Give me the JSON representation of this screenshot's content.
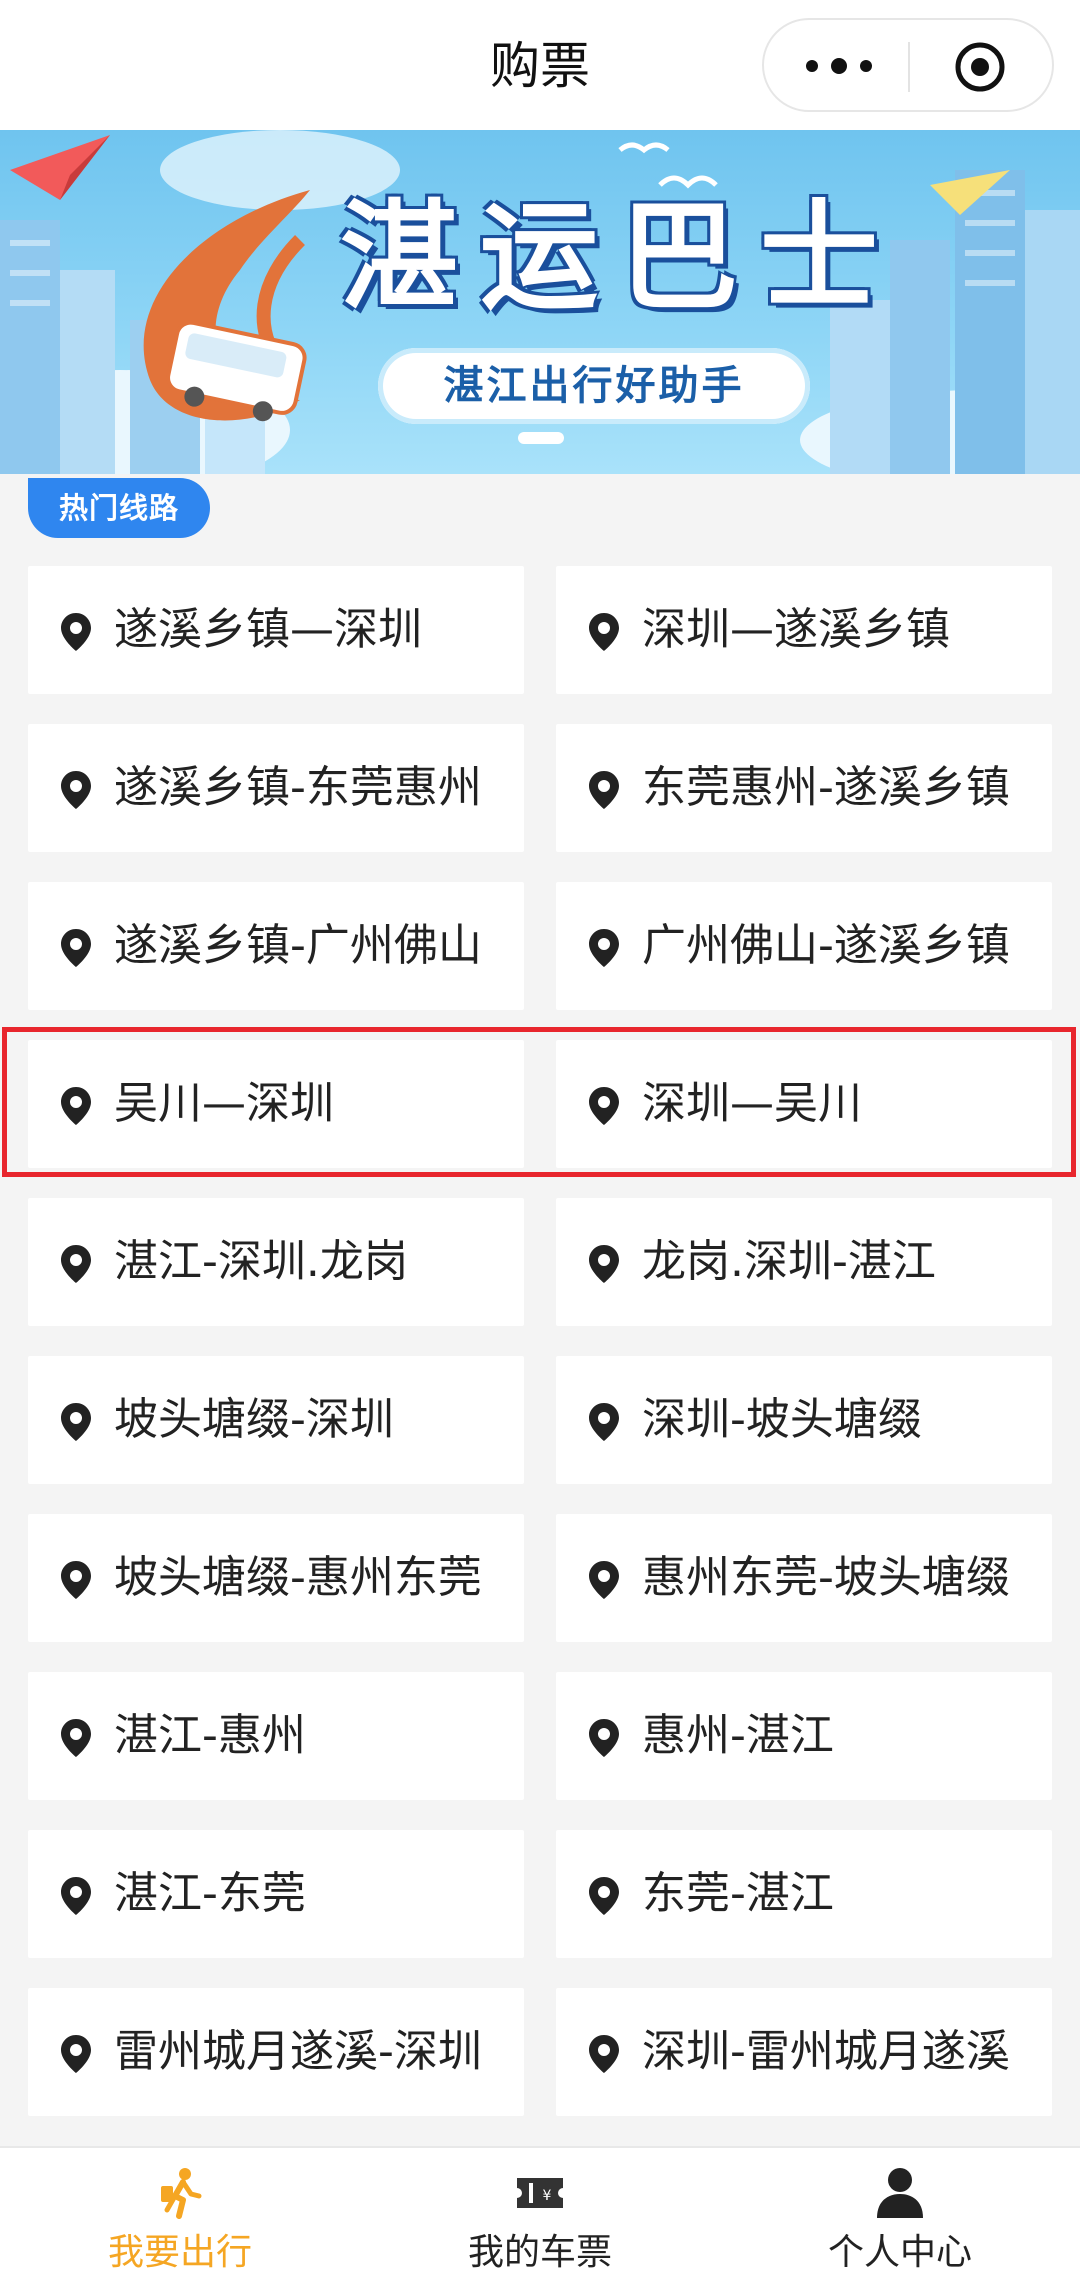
{
  "header": {
    "title": "购票",
    "more_icon": "more-dots-icon",
    "close_icon": "target-close-icon"
  },
  "banner": {
    "title": "湛运巴士",
    "slogan": "湛江出行好助手"
  },
  "section": {
    "hot_routes_label": "热门线路"
  },
  "routes": [
    {
      "label": "遂溪乡镇—深圳"
    },
    {
      "label": "深圳—遂溪乡镇"
    },
    {
      "label": "遂溪乡镇-东莞惠州"
    },
    {
      "label": "东莞惠州-遂溪乡镇"
    },
    {
      "label": "遂溪乡镇-广州佛山"
    },
    {
      "label": "广州佛山-遂溪乡镇"
    },
    {
      "label": "吴川—深圳"
    },
    {
      "label": "深圳—吴川"
    },
    {
      "label": "湛江-深圳.龙岗"
    },
    {
      "label": "龙岗.深圳-湛江"
    },
    {
      "label": "坡头塘缀-深圳"
    },
    {
      "label": "深圳-坡头塘缀"
    },
    {
      "label": "坡头塘缀-惠州东莞"
    },
    {
      "label": "惠州东莞-坡头塘缀"
    },
    {
      "label": "湛江-惠州"
    },
    {
      "label": "惠州-湛江"
    },
    {
      "label": "湛江-东莞"
    },
    {
      "label": "东莞-湛江"
    },
    {
      "label": "雷州城月遂溪-深圳"
    },
    {
      "label": "深圳-雷州城月遂溪"
    }
  ],
  "tabbar": {
    "items": [
      {
        "label": "我要出行",
        "icon": "walking-person-icon",
        "active": true
      },
      {
        "label": "我的车票",
        "icon": "ticket-icon",
        "active": false
      },
      {
        "label": "个人中心",
        "icon": "user-icon",
        "active": false
      }
    ]
  },
  "colors": {
    "accent_active": "#f5a623",
    "tag_blue": "#2f86ef",
    "highlight_red": "#e8262d"
  }
}
